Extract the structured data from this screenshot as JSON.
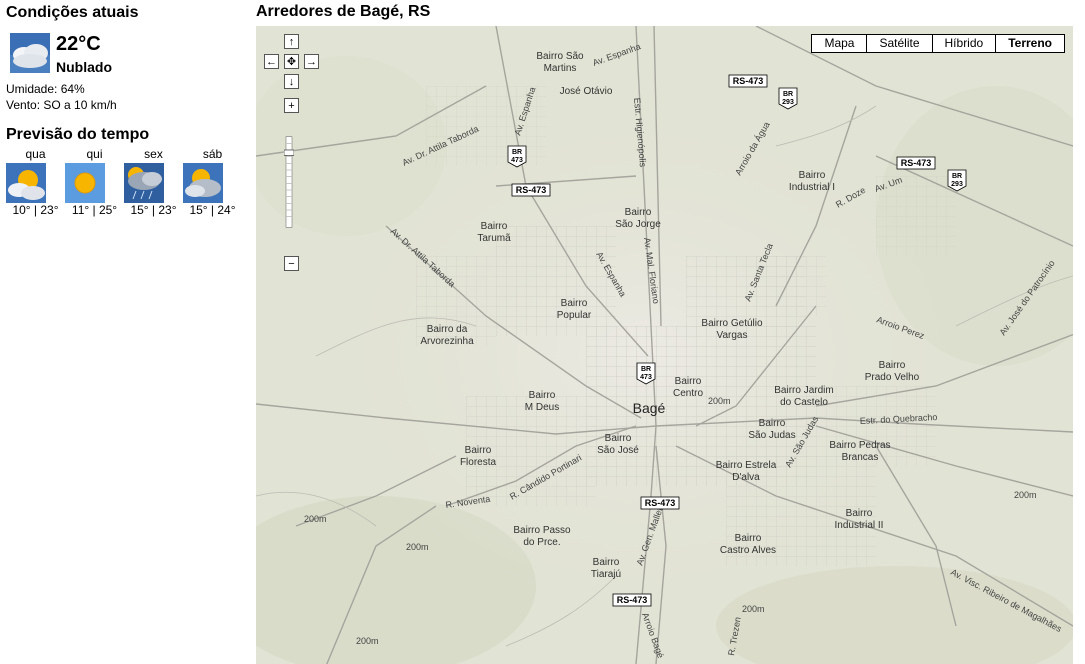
{
  "weather": {
    "current_title": "Condições atuais",
    "temp": "22°C",
    "condition": "Nublado",
    "humidity": "Umidade: 64%",
    "wind": "Vento: SO a 10 km/h",
    "forecast_title": "Previsão do tempo",
    "forecast": [
      {
        "day": "qua",
        "temps": "10° | 23°",
        "icon": "partly-cloudy-icon"
      },
      {
        "day": "qui",
        "temps": "11° | 25°",
        "icon": "sun-icon"
      },
      {
        "day": "sex",
        "temps": "15° | 23°",
        "icon": "storm-icon"
      },
      {
        "day": "sáb",
        "temps": "15° | 24°",
        "icon": "partly-cloudy-icon"
      }
    ]
  },
  "map": {
    "title": "Arredores de Bagé, RS",
    "types": [
      "Mapa",
      "Satélite",
      "Híbrido",
      "Terreno"
    ],
    "active_type": "Terreno",
    "labels": [
      {
        "id": "bairro-sao-martins",
        "text": [
          "Bairro São",
          "Martins"
        ]
      },
      {
        "id": "jose-otavio",
        "text": [
          "José Otávio"
        ]
      },
      {
        "id": "bairro-sao-jorge",
        "text": [
          "Bairro",
          "São Jorge"
        ]
      },
      {
        "id": "bairro-taruma",
        "text": [
          "Bairro",
          "Tarumã"
        ]
      },
      {
        "id": "bairro-popular",
        "text": [
          "Bairro",
          "Popular"
        ]
      },
      {
        "id": "bairro-arvorezinha",
        "text": [
          "Bairro da",
          "Arvorezinha"
        ]
      },
      {
        "id": "bairro-industrial-i",
        "text": [
          "Bairro",
          "Industrial I"
        ]
      },
      {
        "id": "bairro-getulio-vargas",
        "text": [
          "Bairro Getúlio",
          "Vargas"
        ]
      },
      {
        "id": "bairro-prado-velho",
        "text": [
          "Bairro",
          "Prado Velho"
        ]
      },
      {
        "id": "bairro-m-deus",
        "text": [
          "Bairro",
          "M Deus"
        ]
      },
      {
        "id": "bairro-centro",
        "text": [
          "Bairro",
          "Centro"
        ]
      },
      {
        "id": "bairro-jardim-castelo",
        "text": [
          "Bairro Jardim",
          "do Castelo"
        ]
      },
      {
        "id": "bage",
        "text": [
          "Bagé"
        ]
      },
      {
        "id": "bairro-sao-jose",
        "text": [
          "Bairro",
          "São José"
        ]
      },
      {
        "id": "bairro-sao-judas",
        "text": [
          "Bairro",
          "São Judas"
        ]
      },
      {
        "id": "bairro-pedras-brancas",
        "text": [
          "Bairro Pedras",
          "Brancas"
        ]
      },
      {
        "id": "bairro-floresta",
        "text": [
          "Bairro",
          "Floresta"
        ]
      },
      {
        "id": "bairro-estrela-dalva",
        "text": [
          "Bairro Estrela",
          "D'alva"
        ]
      },
      {
        "id": "bairro-industrial-ii",
        "text": [
          "Bairro",
          "Industrial II"
        ]
      },
      {
        "id": "bairro-passo-prce",
        "text": [
          "Bairro Passo",
          "do Prce."
        ]
      },
      {
        "id": "bairro-castro-alves",
        "text": [
          "Bairro",
          "Castro Alves"
        ]
      },
      {
        "id": "bairro-tiaraju",
        "text": [
          "Bairro",
          "Tiarajú"
        ]
      }
    ],
    "streets": [
      {
        "id": "av-espanha-1",
        "text": "Av. Espanha"
      },
      {
        "id": "av-espanha-2",
        "text": "Av. Espanha"
      },
      {
        "id": "av-espanha-3",
        "text": "Av. Espanha"
      },
      {
        "id": "estr-higienopolis",
        "text": "Estr. Higienópolis"
      },
      {
        "id": "av-attila-1",
        "text": "Av. Dr. Attila Taborda"
      },
      {
        "id": "av-attila-2",
        "text": "Av. Dr. Attila Taborda"
      },
      {
        "id": "av-mal-floriano",
        "text": "Av. Mal. Floriano"
      },
      {
        "id": "av-santa-tecla",
        "text": "Av. Santa Tecla"
      },
      {
        "id": "arroio-da-agua",
        "text": "Arroio da Água"
      },
      {
        "id": "r-doze",
        "text": "R. Doze"
      },
      {
        "id": "av-um",
        "text": "Av. Um"
      },
      {
        "id": "arroio-perez",
        "text": "Arroio Perez"
      },
      {
        "id": "av-jose-patrocinio",
        "text": "Av. José do Patrocínio"
      },
      {
        "id": "estr-quebracho",
        "text": "Estr. do Quebracho"
      },
      {
        "id": "av-sao-judas",
        "text": "Av. São Judas"
      },
      {
        "id": "r-candido",
        "text": "R. Cândido Portinari"
      },
      {
        "id": "r-noventa",
        "text": "R. Noventa"
      },
      {
        "id": "av-gen-mallet",
        "text": "Av. Gen. Mallet"
      },
      {
        "id": "arroio-bage",
        "text": "Arroio Bagé"
      },
      {
        "id": "av-visc-ribeiro",
        "text": "Av. Visc. Ribeiro de Magalhães"
      },
      {
        "id": "r-trezentos",
        "text": "R. Trezen"
      },
      {
        "id": "elev-1",
        "text": "200m"
      },
      {
        "id": "elev-2",
        "text": "200m"
      },
      {
        "id": "elev-3",
        "text": "200m"
      },
      {
        "id": "elev-4",
        "text": "200m"
      },
      {
        "id": "elev-5",
        "text": "200m"
      },
      {
        "id": "elev-6",
        "text": "200m"
      },
      {
        "id": "elev-7",
        "text": "200m"
      }
    ],
    "shields": [
      {
        "id": "rs473-a",
        "text": "RS-473"
      },
      {
        "id": "rs473-b",
        "text": "RS-473"
      },
      {
        "id": "rs473-c",
        "text": "RS-473"
      },
      {
        "id": "rs473-d",
        "text": "RS-473"
      },
      {
        "id": "rs473-e",
        "text": "RS-473"
      },
      {
        "id": "rs473-f",
        "text": "RS-473"
      },
      {
        "id": "br293-a",
        "text": [
          "BR",
          "293"
        ]
      },
      {
        "id": "br293-b",
        "text": [
          "BR",
          "293"
        ]
      },
      {
        "id": "br473-a",
        "text": [
          "BR",
          "473"
        ]
      },
      {
        "id": "br473-b",
        "text": [
          "BR",
          "473"
        ]
      }
    ]
  }
}
